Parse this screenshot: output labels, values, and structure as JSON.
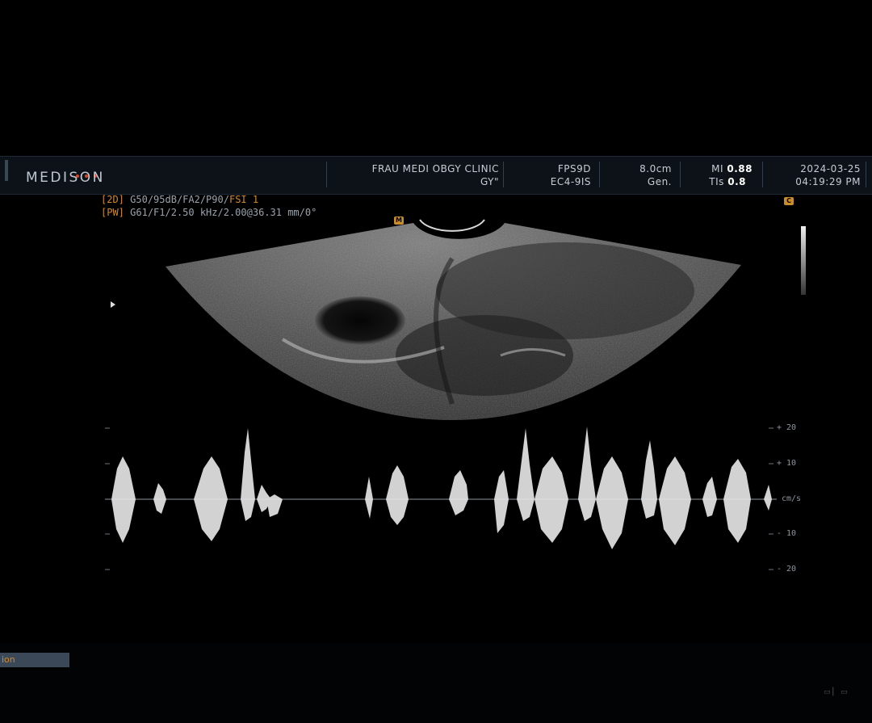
{
  "header": {
    "brand": "MEDISON",
    "clinic": "FRAU MEDI OBGY CLINIC",
    "preset": "GY\"",
    "probe_mode": "FPS9D",
    "probe": "EC4-9IS",
    "depth": "8.0cm",
    "depth_sub": "Gen.",
    "mi_label": "MI",
    "mi_value": "0.88",
    "tis_label": "TIs",
    "tis_value": "0.8",
    "date": "2024-03-25",
    "time": "04:19:29 PM"
  },
  "params": {
    "line1_tag": "[2D]",
    "line1_text": "G50/95dB/FA2/P90/",
    "line1_fsi": "FSI 1",
    "line2_tag": "[PW]",
    "line2_text": "G61/F1/2.50 kHz/2.00@36.31 mm/0°"
  },
  "markers": {
    "probe_marker": "M",
    "top_right_marker": "C"
  },
  "doppler_scale": {
    "labels": [
      "+ 20",
      "+ 10",
      "cm/s",
      "- 10",
      "- 20"
    ]
  },
  "bottom": {
    "tab_label": "ion"
  },
  "colors": {
    "accent_orange": "#d28a2a",
    "brand_red": "#d9432c",
    "header_bg": "#0c1218"
  }
}
